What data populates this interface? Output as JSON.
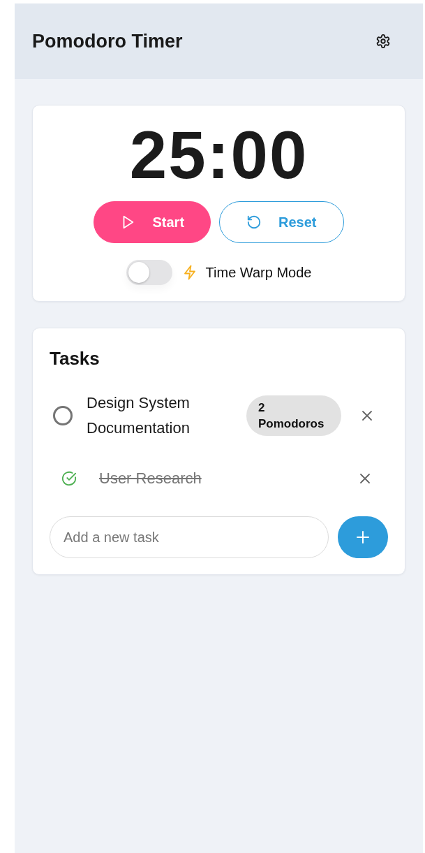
{
  "header": {
    "title": "Pomodoro Timer"
  },
  "timer": {
    "display": "25:00",
    "buttons": [
      {
        "kind": "start",
        "label": "Start"
      },
      {
        "kind": "reset",
        "label": "Reset"
      }
    ],
    "time_warp": {
      "label": "Time Warp Mode",
      "on": false
    }
  },
  "tasks": {
    "title": "Tasks",
    "items": [
      {
        "text": "Design System Documentation",
        "completed": false,
        "badge": "2 Pomodoros"
      },
      {
        "text": "User Research",
        "completed": true
      }
    ],
    "new_task": {
      "placeholder": "Add a new task"
    }
  }
}
